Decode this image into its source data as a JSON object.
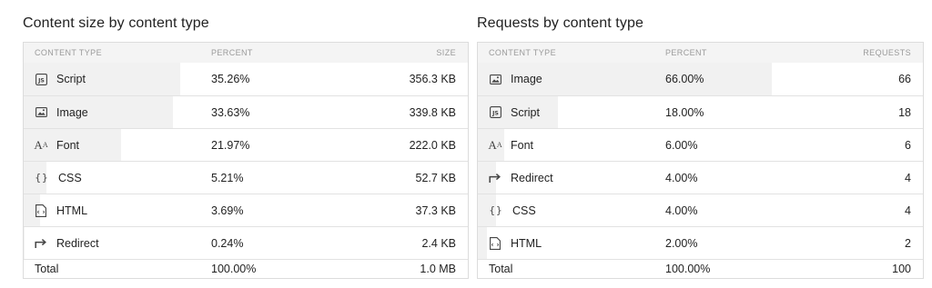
{
  "left": {
    "title": "Content size by content type",
    "headers": {
      "type": "CONTENT TYPE",
      "percent": "PERCENT",
      "value": "SIZE"
    },
    "rows": [
      {
        "icon": "js-file-icon",
        "type": "Script",
        "percent": "35.26%",
        "value": "356.3 KB",
        "fraction": 0.3526
      },
      {
        "icon": "image-icon",
        "type": "Image",
        "percent": "33.63%",
        "value": "339.8 KB",
        "fraction": 0.3363
      },
      {
        "icon": "font-icon",
        "type": "Font",
        "percent": "21.97%",
        "value": "222.0 KB",
        "fraction": 0.2197
      },
      {
        "icon": "braces-icon",
        "type": "CSS",
        "percent": "5.21%",
        "value": "52.7 KB",
        "fraction": 0.0521
      },
      {
        "icon": "html-file-icon",
        "type": "HTML",
        "percent": "3.69%",
        "value": "37.3 KB",
        "fraction": 0.0369
      },
      {
        "icon": "redirect-icon",
        "type": "Redirect",
        "percent": "0.24%",
        "value": "2.4 KB",
        "fraction": 0.0024
      }
    ],
    "total": {
      "label": "Total",
      "percent": "100.00%",
      "value": "1.0 MB"
    }
  },
  "right": {
    "title": "Requests by content type",
    "headers": {
      "type": "CONTENT TYPE",
      "percent": "PERCENT",
      "value": "REQUESTS"
    },
    "rows": [
      {
        "icon": "image-icon",
        "type": "Image",
        "percent": "66.00%",
        "value": "66",
        "fraction": 0.66
      },
      {
        "icon": "js-file-icon",
        "type": "Script",
        "percent": "18.00%",
        "value": "18",
        "fraction": 0.18
      },
      {
        "icon": "font-icon",
        "type": "Font",
        "percent": "6.00%",
        "value": "6",
        "fraction": 0.06
      },
      {
        "icon": "redirect-icon",
        "type": "Redirect",
        "percent": "4.00%",
        "value": "4",
        "fraction": 0.04
      },
      {
        "icon": "braces-icon",
        "type": "CSS",
        "percent": "4.00%",
        "value": "4",
        "fraction": 0.04
      },
      {
        "icon": "html-file-icon",
        "type": "HTML",
        "percent": "2.00%",
        "value": "2",
        "fraction": 0.02
      }
    ],
    "total": {
      "label": "Total",
      "percent": "100.00%",
      "value": "100"
    }
  },
  "colors": {
    "bar": "#f1f1f1",
    "border": "#dcdcdc",
    "header_bg": "#f4f4f4",
    "header_text": "#9a9a9a"
  }
}
